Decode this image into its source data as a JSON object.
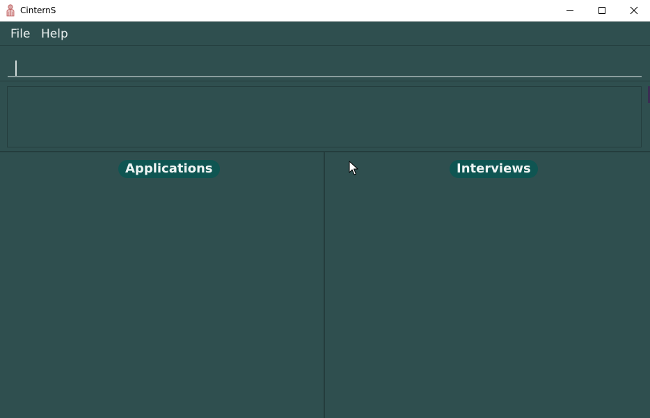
{
  "window": {
    "title": "CinternS",
    "controls": {
      "minimize_icon": "minimize-icon",
      "maximize_icon": "maximize-icon",
      "close_icon": "close-icon"
    }
  },
  "menubar": {
    "items": [
      {
        "label": "File"
      },
      {
        "label": "Help"
      }
    ]
  },
  "command_box": {
    "value": "",
    "placeholder": ""
  },
  "result_display": {
    "text": ""
  },
  "panels": {
    "applications": {
      "title": "Applications"
    },
    "interviews": {
      "title": "Interviews"
    }
  },
  "colors": {
    "background": "#2f4f4f",
    "header_pill": "#0f5552",
    "text": "#e8efee"
  }
}
